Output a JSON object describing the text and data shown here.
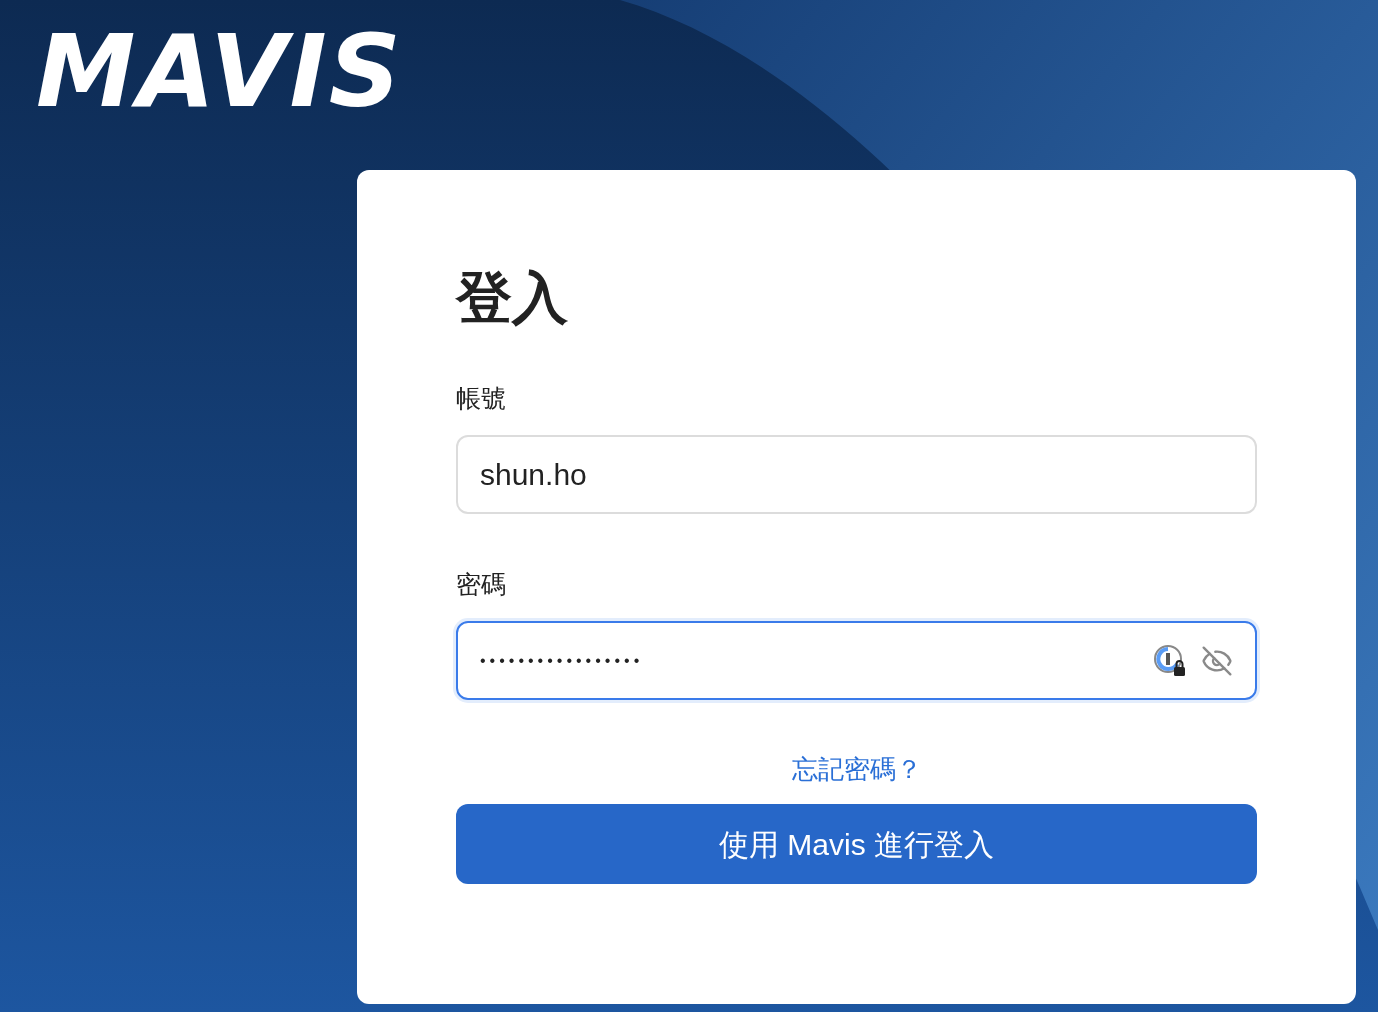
{
  "logo": "MAVIS",
  "title": "登入",
  "username": {
    "label": "帳號",
    "value": "shun.ho"
  },
  "password": {
    "label": "密碼",
    "value": "•••••••••••••••••",
    "focused": true
  },
  "forgot_link": "忘記密碼？",
  "submit_button": "使用 Mavis 進行登入"
}
